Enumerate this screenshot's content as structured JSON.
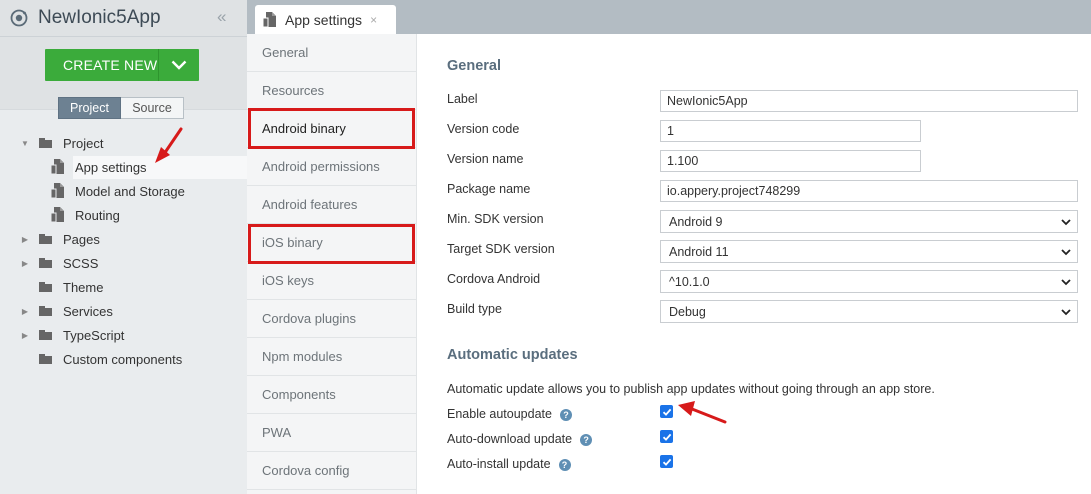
{
  "app": {
    "title": "NewIonic5App",
    "collapse_glyph": "«"
  },
  "create_button": {
    "label": "CREATE NEW"
  },
  "view_toggle": {
    "project": "Project",
    "source": "Source"
  },
  "tree": {
    "project": "Project",
    "app_settings": "App settings",
    "model_storage": "Model and Storage",
    "routing": "Routing",
    "pages": "Pages",
    "scss": "SCSS",
    "theme": "Theme",
    "services": "Services",
    "typescript": "TypeScript",
    "custom_components": "Custom components"
  },
  "tab": {
    "label": "App settings",
    "close": "×"
  },
  "nav": {
    "general": "General",
    "resources": "Resources",
    "android_binary": "Android binary",
    "android_permissions": "Android permissions",
    "android_features": "Android features",
    "ios_binary": "iOS binary",
    "ios_keys": "iOS keys",
    "cordova_plugins": "Cordova plugins",
    "npm_modules": "Npm modules",
    "components": "Components",
    "pwa": "PWA",
    "cordova_config": "Cordova config"
  },
  "general": {
    "title": "General",
    "label_label": "Label",
    "label_value": "NewIonic5App",
    "version_code_label": "Version code",
    "version_code_value": "1",
    "version_name_label": "Version name",
    "version_name_value": "1.100",
    "package_name_label": "Package name",
    "package_name_value": "io.appery.project748299",
    "min_sdk_label": "Min. SDK version",
    "min_sdk_value": "Android 9",
    "target_sdk_label": "Target SDK version",
    "target_sdk_value": "Android 11",
    "cordova_android_label": "Cordova Android",
    "cordova_android_value": "^10.1.0",
    "build_type_label": "Build type",
    "build_type_value": "Debug"
  },
  "updates": {
    "title": "Automatic updates",
    "description": "Automatic update allows you to publish app updates without going through an app store.",
    "enable_label": "Enable autoupdate",
    "download_label": "Auto-download update",
    "install_label": "Auto-install update",
    "help_glyph": "?"
  },
  "colors": {
    "create_green": "#3bab3b",
    "highlight_red": "#d71a1a",
    "checkbox_blue": "#1a73e8",
    "section_title": "#5a6e7e"
  }
}
